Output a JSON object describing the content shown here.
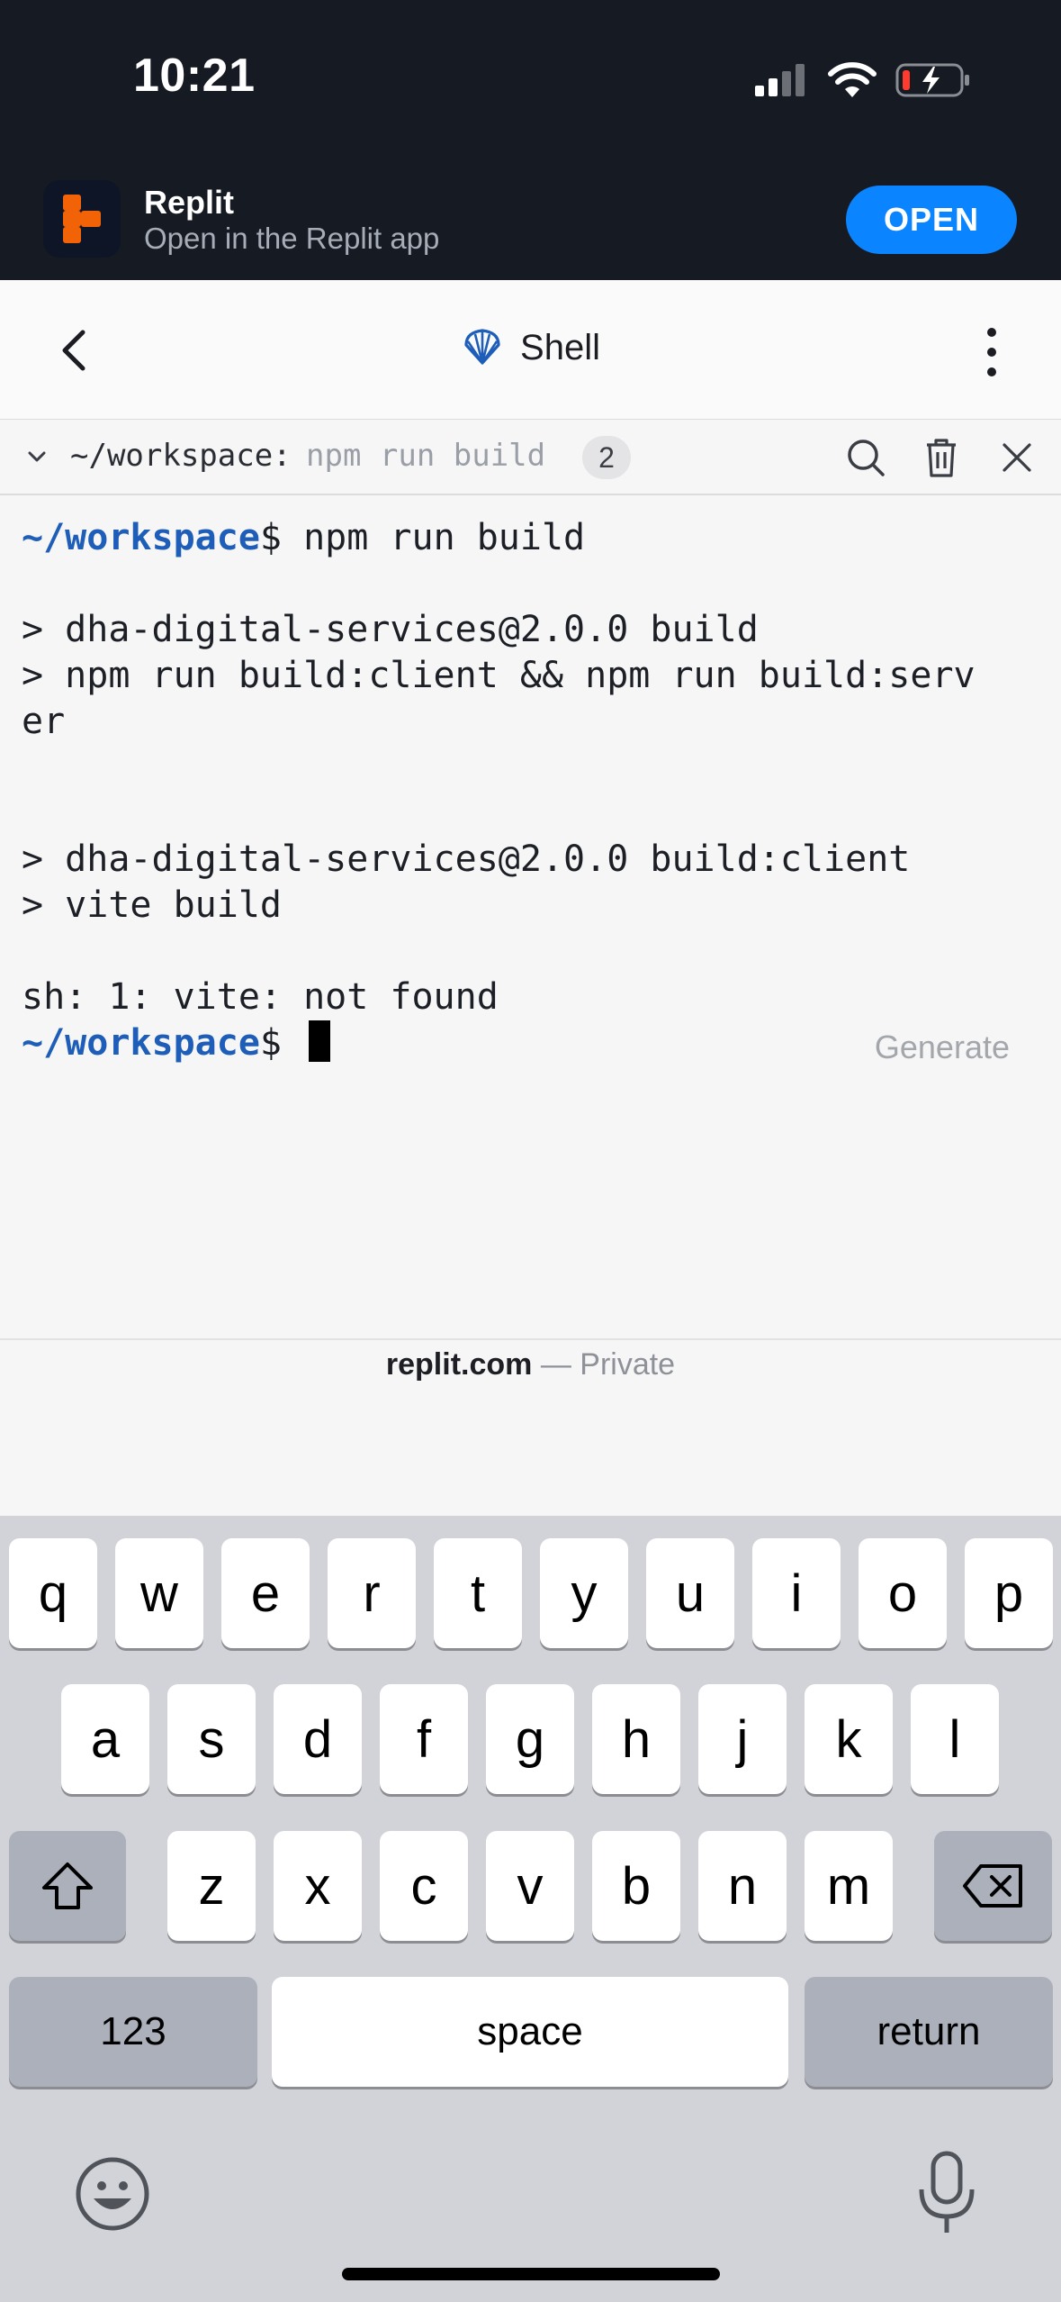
{
  "status_bar": {
    "time": "10:21",
    "icons": [
      "signal-icon",
      "wifi-icon",
      "battery-charging-icon"
    ]
  },
  "app_banner": {
    "title": "Replit",
    "subtitle": "Open in the Replit app",
    "open_label": "OPEN",
    "accent": "#0b84ff"
  },
  "header": {
    "title": "Shell",
    "icons": [
      "back-chevron-icon",
      "shell-icon",
      "more-vertical-icon"
    ]
  },
  "shell_tab": {
    "path": "~/workspace:",
    "command": "npm run build",
    "badge": "2"
  },
  "terminal": {
    "prompt": "~/workspace",
    "line1_cmd": "$ npm run build",
    "out1": "> dha-digital-services@2.0.0 build",
    "out2": "> npm run build:client && npm run build:serv",
    "out3": "er",
    "out4": "> dha-digital-services@2.0.0 build:client",
    "out5": "> vite build",
    "out6": "sh: 1: vite: not found",
    "prompt_suffix": "$ ",
    "generate_label": "Generate"
  },
  "footer": {
    "domain": "replit.com",
    "visibility": " — Private"
  },
  "keyboard": {
    "row1": [
      "q",
      "w",
      "e",
      "r",
      "t",
      "y",
      "u",
      "i",
      "o",
      "p"
    ],
    "row2": [
      "a",
      "s",
      "d",
      "f",
      "g",
      "h",
      "j",
      "k",
      "l"
    ],
    "row3": [
      "z",
      "x",
      "c",
      "v",
      "b",
      "n",
      "m"
    ],
    "numbers_label": "123",
    "space_label": "space",
    "return_label": "return"
  }
}
